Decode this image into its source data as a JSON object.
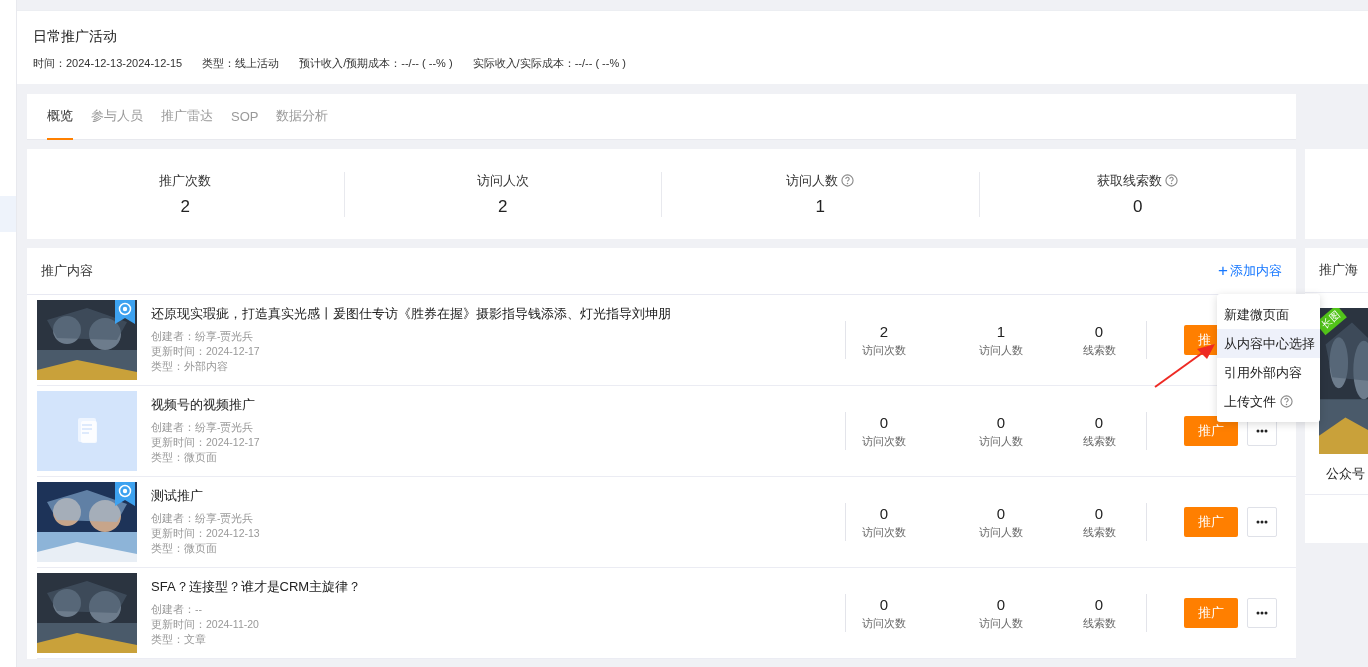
{
  "activity": {
    "title": "日常推广活动",
    "meta": [
      {
        "label": "时间：",
        "value": "2024-12-13-2024-12-15"
      },
      {
        "label": "类型：",
        "value": "线上活动"
      },
      {
        "label": "预计收入/预期成本：",
        "value": "--/-- ( --% )"
      },
      {
        "label": "实际收入/实际成本：",
        "value": "--/-- ( --% )"
      }
    ]
  },
  "tabs": [
    {
      "label": "概览",
      "selected": true
    },
    {
      "label": "参与人员",
      "selected": false
    },
    {
      "label": "推广雷达",
      "selected": false
    },
    {
      "label": "SOP",
      "selected": false
    },
    {
      "label": "数据分析",
      "selected": false
    }
  ],
  "stats": [
    {
      "label": "推广次数",
      "value": "2",
      "help": false
    },
    {
      "label": "访问人次",
      "value": "2",
      "help": false
    },
    {
      "label": "访问人数",
      "value": "1",
      "help": true
    },
    {
      "label": "获取线索数",
      "value": "0",
      "help": true
    }
  ],
  "content": {
    "title": "推广内容",
    "add_link": {
      "icon": "+",
      "label": "添加内容"
    },
    "rows": [
      {
        "kind": "picture",
        "badge": true,
        "title": "还原现实瑕疵，打造真实光感丨爰图仕专访《胜券在握》摄影指导钱添添、灯光指导刘坤朋",
        "creator": "创建者：纷享-贾光兵",
        "updated": "更新时间：2024-12-17",
        "type": "类型：外部内容",
        "stats": [
          {
            "value": "2",
            "label": "访问次数"
          },
          {
            "value": "1",
            "label": "访问人数"
          },
          {
            "value": "0",
            "label": "线索数"
          }
        ],
        "button": "推",
        "more_button": false
      },
      {
        "kind": "placeholder",
        "badge": false,
        "title": "视频号的视频推广",
        "creator": "创建者：纷享-贾光兵",
        "updated": "更新时间：2024-12-17",
        "type": "类型：微页面",
        "stats": [
          {
            "value": "0",
            "label": "访问次数"
          },
          {
            "value": "0",
            "label": "访问人数"
          },
          {
            "value": "0",
            "label": "线索数"
          }
        ],
        "button": "推广",
        "more_button": true
      },
      {
        "kind": "picture",
        "badge": true,
        "title": "测试推广",
        "creator": "创建者：纷享-贾光兵",
        "updated": "更新时间：2024-12-13",
        "type": "类型：微页面",
        "stats": [
          {
            "value": "0",
            "label": "访问次数"
          },
          {
            "value": "0",
            "label": "访问人数"
          },
          {
            "value": "0",
            "label": "线索数"
          }
        ],
        "button": "推广",
        "more_button": true
      },
      {
        "kind": "picture",
        "badge": false,
        "title": "SFA？连接型？谁才是CRM主旋律？",
        "creator": "创建者：--",
        "updated": "更新时间：2024-11-20",
        "type": "类型：文章",
        "stats": [
          {
            "value": "0",
            "label": "访问次数"
          },
          {
            "value": "0",
            "label": "访问人数"
          },
          {
            "value": "0",
            "label": "线索数"
          }
        ],
        "button": "推广",
        "more_button": true
      }
    ],
    "menu": [
      {
        "label": "新建微页面",
        "selected": false,
        "help": false
      },
      {
        "label": "从内容中心选择",
        "selected": true,
        "help": false
      },
      {
        "label": "引用外部内容",
        "selected": false,
        "help": false
      },
      {
        "label": "上传文件",
        "selected": false,
        "help": true
      }
    ]
  },
  "poster": {
    "title": "推广海",
    "tag": "长图",
    "caption": "公众号"
  }
}
